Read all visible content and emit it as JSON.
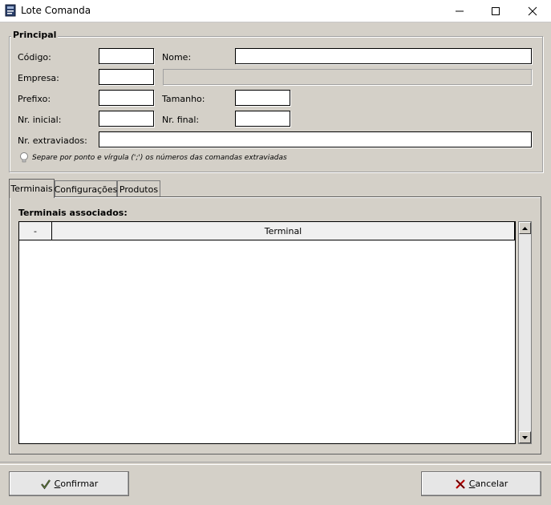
{
  "window": {
    "title": "Lote Comanda",
    "minimize": "—",
    "maximize": "☐",
    "close": "✕"
  },
  "principal": {
    "title": "Principal",
    "codigo_label": "Código:",
    "codigo_value": "",
    "nome_label": "Nome:",
    "nome_value": "",
    "empresa_label": "Empresa:",
    "empresa_value": "",
    "empresa_desc": "",
    "prefixo_label": "Prefixo:",
    "prefixo_value": "",
    "tamanho_label": "Tamanho:",
    "tamanho_value": "",
    "nr_inicial_label": "Nr. inicial:",
    "nr_inicial_value": "",
    "nr_final_label": "Nr. final:",
    "nr_final_value": "",
    "nr_extraviados_label": "Nr. extraviados:",
    "nr_extraviados_value": "",
    "hint": "Separe por ponto e vírgula (';') os números das comandas extraviadas"
  },
  "tabs": [
    {
      "label": "Terminais",
      "active": true
    },
    {
      "label": "Configurações",
      "active": false
    },
    {
      "label": "Produtos",
      "active": false
    }
  ],
  "terminais": {
    "title": "Terminais associados:",
    "columns": [
      "-",
      "Terminal"
    ],
    "rows": []
  },
  "buttons": {
    "confirm_first": "C",
    "confirm_rest": "onfirmar",
    "cancel_first": "C",
    "cancel_rest": "ancelar"
  },
  "icons": {
    "app": "app-icon",
    "hint": "lightbulb-icon",
    "confirm": "checkmark-icon",
    "cancel": "x-icon"
  }
}
